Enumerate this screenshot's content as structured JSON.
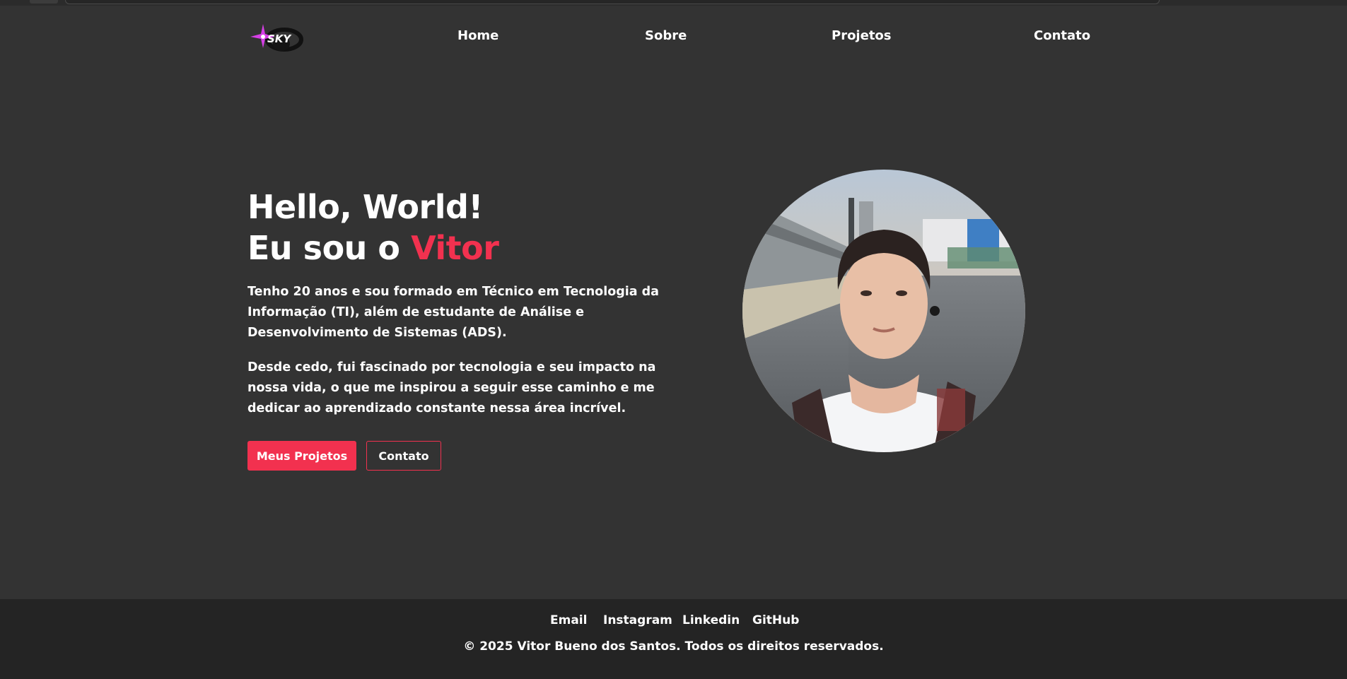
{
  "header": {
    "logo_text": "SKY",
    "nav": [
      {
        "label": "Home"
      },
      {
        "label": "Sobre"
      },
      {
        "label": "Projetos"
      },
      {
        "label": "Contato"
      }
    ]
  },
  "hero": {
    "title_line1": "Hello, World!",
    "title_line2_prefix": "Eu sou o ",
    "title_name": "Vitor",
    "paragraph1": "Tenho 20 anos e sou formado em Técnico em Tecnologia da Informação (TI), além de estudante de Análise e Desenvolvimento de Sistemas (ADS).",
    "paragraph2": "Desde cedo, fui fascinado por tecnologia e seu impacto na nossa vida, o que me inspirou a seguir esse caminho e me dedicar ao aprendizado constante nessa área incrível.",
    "primary_button": "Meus Projetos",
    "secondary_button": "Contato"
  },
  "footer": {
    "links": [
      {
        "label": "Email"
      },
      {
        "label": "Instagram"
      },
      {
        "label": "Linkedin"
      },
      {
        "label": "GitHub"
      }
    ],
    "copyright": "© 2025 Vitor Bueno dos Santos. Todos os direitos reservados."
  },
  "colors": {
    "background": "#333333",
    "footer_background": "#242424",
    "accent": "#f2314f",
    "text": "#ffffff",
    "logo_accent": "#d63fe6"
  },
  "icons": {
    "logo": "sky-logo-icon",
    "profile_photo": "profile-photo"
  }
}
